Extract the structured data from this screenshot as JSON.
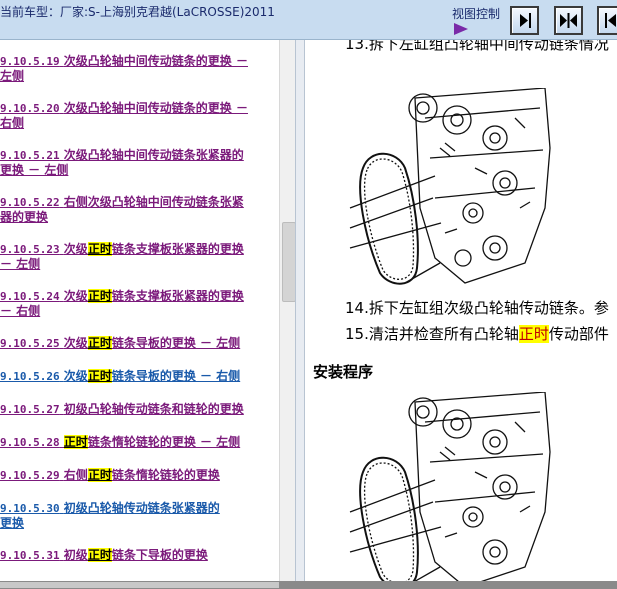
{
  "header": {
    "title": "当前车型：厂家:S-上海别克君越(LaCROSSE)2011",
    "view_control_label": "视图控制",
    "buttons": [
      "expand-right-icon",
      "collapse-both-icon",
      "expand-left-icon"
    ]
  },
  "toc": {
    "items": [
      {
        "num": "9.10.5.19",
        "before": "次级凸轮轴中间传动链条的更换 －",
        "hl": "",
        "after": "",
        "line2": "左侧",
        "color": "purple"
      },
      {
        "num": "9.10.5.20",
        "before": "次级凸轮轴中间传动链条的更换 －",
        "hl": "",
        "after": "",
        "line2": "右侧",
        "color": "purple"
      },
      {
        "num": "9.10.5.21",
        "before": "次级凸轮轴中间传动链条张紧器的",
        "hl": "",
        "after": "",
        "line2": "更换 － 左侧",
        "color": "purple"
      },
      {
        "num": "9.10.5.22",
        "before": "右侧次级凸轮轴中间传动链条张紧",
        "hl": "",
        "after": "",
        "line2": "器的更换",
        "color": "purple"
      },
      {
        "num": "9.10.5.23",
        "before": "次级",
        "hl": "正时",
        "after": "链条支撑板张紧器的更换",
        "line2": "－ 左侧",
        "color": "purple"
      },
      {
        "num": "9.10.5.24",
        "before": "次级",
        "hl": "正时",
        "after": "链条支撑板张紧器的更换",
        "line2": "－ 右侧",
        "color": "purple"
      },
      {
        "num": "9.10.5.25",
        "before": "次级",
        "hl": "正时",
        "after": "链条导板的更换 － 左侧",
        "line2": "",
        "color": "purple"
      },
      {
        "num": "9.10.5.26",
        "before": "次级",
        "hl": "正时",
        "after": "链条导板的更换 － 右侧",
        "line2": "",
        "color": "blue"
      },
      {
        "num": "9.10.5.27",
        "before": "初级凸轮轴传动链条和链轮的更换",
        "hl": "",
        "after": "",
        "line2": "",
        "color": "purple"
      },
      {
        "num": "9.10.5.28",
        "before": "",
        "hl": "正时",
        "after": "链条惰轮链轮的更换 － 左侧",
        "line2": "",
        "color": "purple"
      },
      {
        "num": "9.10.5.29",
        "before": "右侧",
        "hl": "正时",
        "after": "链条惰轮链轮的更换",
        "line2": "",
        "color": "purple"
      },
      {
        "num": "9.10.5.30",
        "before": "初级凸轮轴传动链条张紧器的",
        "hl": "",
        "after": "",
        "line2": "更换",
        "color": "blue"
      },
      {
        "num": "9.10.5.31",
        "before": "初级",
        "hl": "正时",
        "after": "链条下导板的更换",
        "line2": "",
        "color": "purple"
      }
    ]
  },
  "content": {
    "step13": "13.拆下左缸组凸轮轴中间传动链条情况",
    "step14": "14.拆下左缸组次级凸轮轴传动链条。参",
    "step15_before": "15.清洁并检查所有凸轮轴",
    "step15_hl": "正时",
    "step15_after": "传动部件",
    "install_heading": "安装程序"
  }
}
